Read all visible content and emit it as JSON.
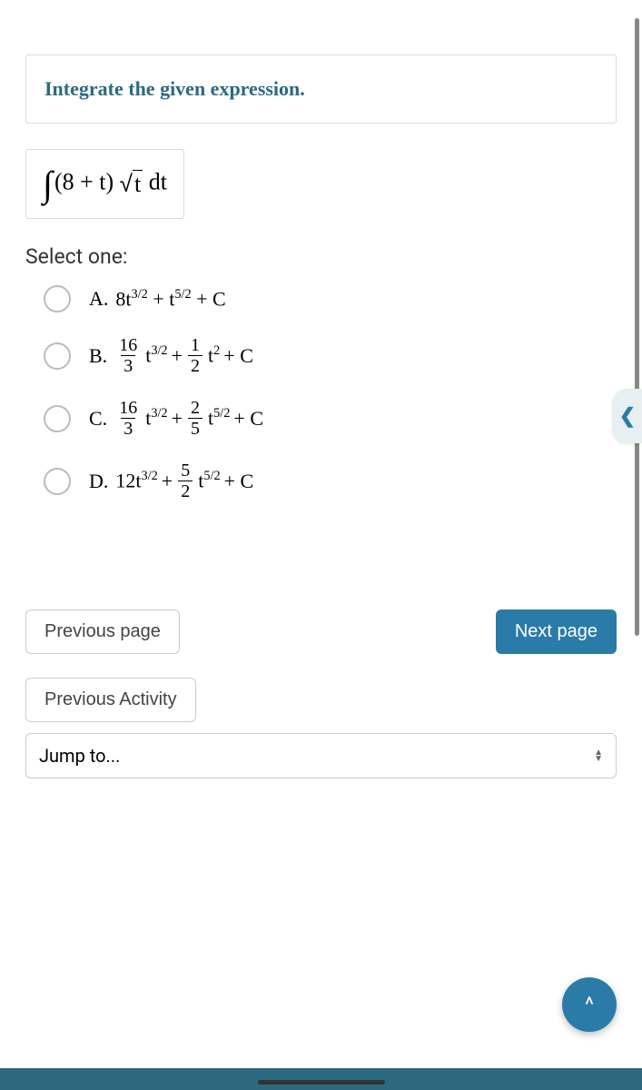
{
  "question": {
    "title": "Integrate the given expression.",
    "integral_parts": {
      "p1": "(8 + t) ",
      "sqrt_content": "t",
      "diff": " dt"
    }
  },
  "select_label": "Select one:",
  "options": {
    "a": {
      "letter": "A.",
      "prefix": "8t",
      "exp1": "3/2",
      "mid": " + t",
      "exp2": "5/2",
      "suffix": " + C"
    },
    "b": {
      "letter": "B.",
      "f1n": "16",
      "f1d": "3",
      "t1": "t",
      "e1": "3/2",
      "plus": " + ",
      "f2n": "1",
      "f2d": "2",
      "t2": "t",
      "e2": "2",
      "suffix": " + C"
    },
    "c": {
      "letter": "C.",
      "f1n": "16",
      "f1d": "3",
      "t1": "t",
      "e1": "3/2",
      "plus": " + ",
      "f2n": "2",
      "f2d": "5",
      "t2": "t",
      "e2": "5/2",
      "suffix": " + C"
    },
    "d": {
      "letter": "D.",
      "prefix": "12t",
      "e1": "3/2",
      "plus": " + ",
      "f2n": "5",
      "f2d": "2",
      "t2": "t",
      "e2": "5/2",
      "suffix": " + C"
    }
  },
  "nav": {
    "prev_page": "Previous page",
    "next_page": "Next page",
    "prev_activity": "Previous Activity",
    "jump": "Jump to..."
  }
}
